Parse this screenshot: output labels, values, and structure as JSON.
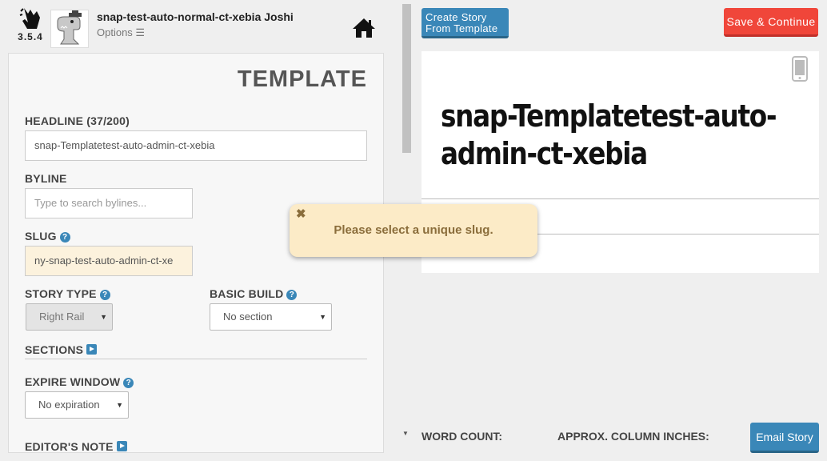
{
  "app": {
    "version": "3.5.4",
    "user_name": "snap-test-auto-normal-ct-xebia Joshi",
    "options_label": "Options ☰"
  },
  "panel": {
    "heading": "TEMPLATE",
    "headline_label": "HEADLINE (37/200)",
    "headline_value": "snap-Templatetest-auto-admin-ct-xebia",
    "byline_label": "BYLINE",
    "byline_placeholder": "Type to search bylines...",
    "slug_label": "SLUG",
    "slug_value": "ny-snap-test-auto-admin-ct-xe",
    "story_type_label": "STORY TYPE",
    "story_type_value": "Right Rail",
    "basic_build_label": "BASIC BUILD",
    "basic_build_value": "No section",
    "sections_label": "SECTIONS",
    "expire_label": "EXPIRE WINDOW",
    "expire_value": "No expiration",
    "editors_note_label": "EDITOR'S NOTE"
  },
  "toolbar": {
    "template_button_line1": "Create Story",
    "template_button_line2": "From Template",
    "save_button": "Save & Continue"
  },
  "preview": {
    "headline": "snap-Templatetest-auto-admin-ct-xebia"
  },
  "toast": {
    "close_glyph": "✖",
    "message": "Please select a unique slug."
  },
  "footer": {
    "word_count_label": "WORD COUNT:",
    "column_inches_label": "APPROX. COLUMN INCHES:",
    "email_button": "Email Story"
  },
  "colors": {
    "accent_blue": "#3a87b8",
    "save_red": "#f0463a",
    "toast_bg": "#fcebc7",
    "slug_warn_bg": "#fcf2dd"
  },
  "icons": [
    "snap-logo-icon",
    "dino-avatar",
    "home-icon",
    "help-icon",
    "sections-play-icon",
    "mobile-device-icon",
    "close-icon",
    "dropdown-caret-icon"
  ]
}
